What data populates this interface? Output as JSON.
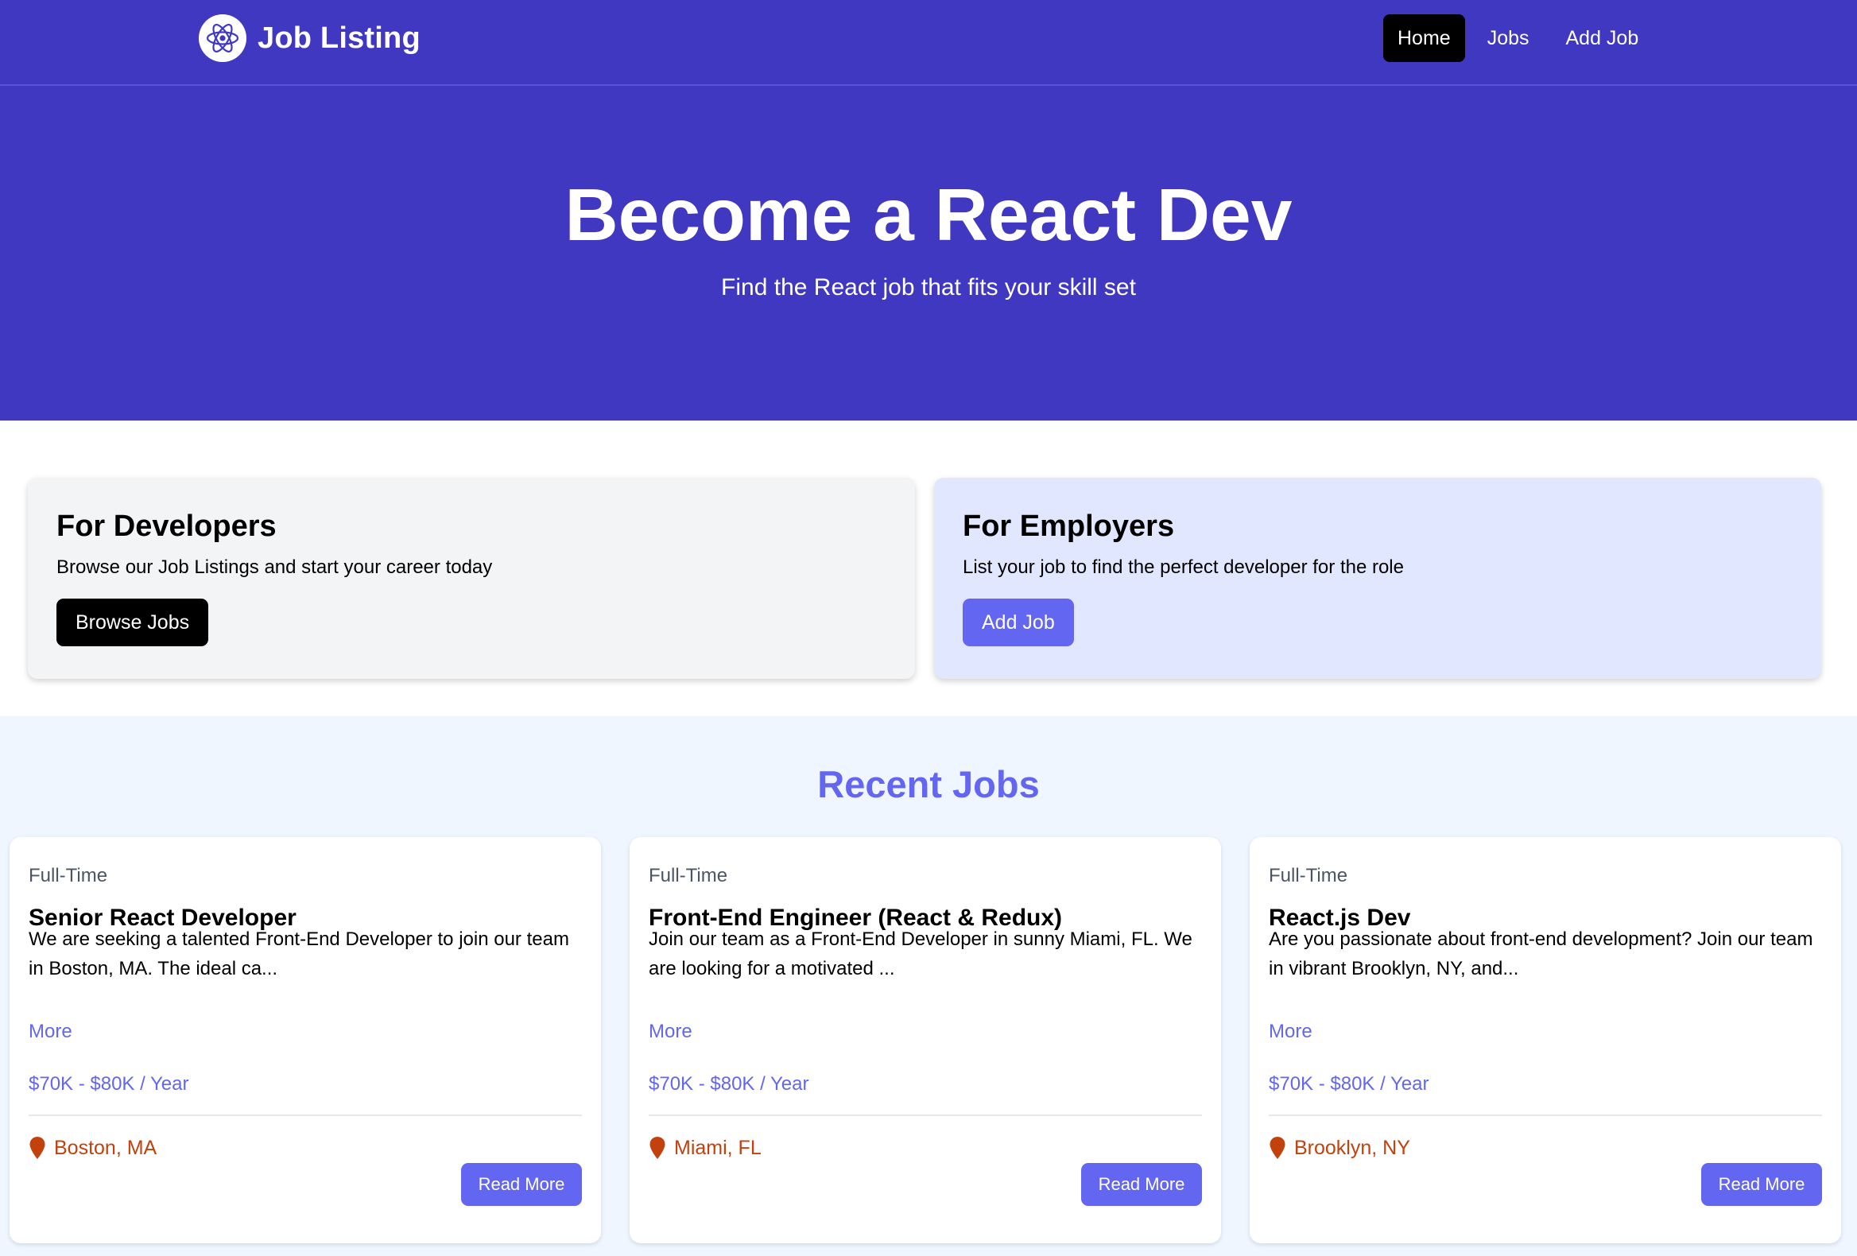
{
  "navbar": {
    "brand_title": "Job Listing",
    "logo_icon": "react-atom-icon",
    "links": [
      {
        "label": "Home",
        "active": true
      },
      {
        "label": "Jobs",
        "active": false
      },
      {
        "label": "Add Job",
        "active": false
      }
    ]
  },
  "hero": {
    "title": "Become a React Dev",
    "subtitle": "Find the React job that fits your skill set"
  },
  "info_cards": {
    "developers": {
      "title": "For Developers",
      "text": "Browse our Job Listings and start your career today",
      "button": "Browse Jobs"
    },
    "employers": {
      "title": "For Employers",
      "text": "List your job to find the perfect developer for the role",
      "button": "Add Job"
    }
  },
  "recent_jobs": {
    "title": "Recent Jobs",
    "jobs": [
      {
        "type": "Full-Time",
        "title": "Senior React Developer",
        "description": "We are seeking a talented Front-End Developer to join our team in Boston, MA. The ideal ca...",
        "more": "More",
        "salary": "$70K - $80K / Year",
        "location": "Boston, MA",
        "button": "Read More"
      },
      {
        "type": "Full-Time",
        "title": "Front-End Engineer (React & Redux)",
        "description": "Join our team as a Front-End Developer in sunny Miami, FL. We are looking for a motivated ...",
        "more": "More",
        "salary": "$70K - $80K / Year",
        "location": "Miami, FL",
        "button": "Read More"
      },
      {
        "type": "Full-Time",
        "title": "React.js Dev",
        "description": "Are you passionate about front-end development? Join our team in vibrant Brooklyn, NY, and...",
        "more": "More",
        "salary": "$70K - $80K / Year",
        "location": "Brooklyn, NY",
        "button": "Read More"
      }
    ]
  },
  "colors": {
    "brand": "#4138c2",
    "accent": "#6366f1",
    "location": "#c2410c",
    "employers_bg": "#e0e7ff",
    "developers_bg": "#f3f4f6",
    "recent_bg": "#eff6ff"
  }
}
